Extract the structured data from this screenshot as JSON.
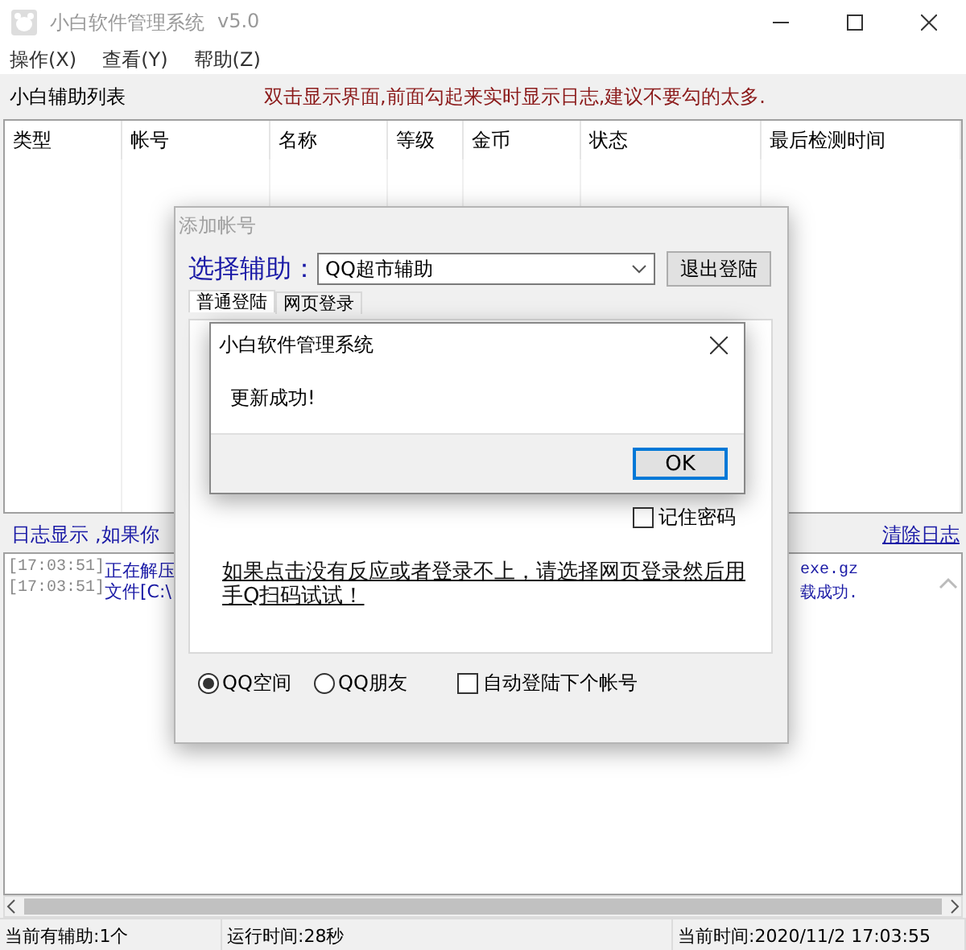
{
  "window": {
    "title": "小白软件管理系统",
    "version": "v5.0"
  },
  "menu": [
    {
      "label": "操作(X)"
    },
    {
      "label": "查看(Y)"
    },
    {
      "label": "帮助(Z)"
    }
  ],
  "list_panel": {
    "title": "小白辅助列表",
    "hint": "双击显示界面,前面勾起来实时显示日志,建议不要勾的太多."
  },
  "table": {
    "columns": [
      "类型",
      "帐号",
      "名称",
      "等级",
      "金币",
      "状态",
      "最后检测时间"
    ]
  },
  "log_bar": {
    "title": "日志显示",
    "message": ",如果你",
    "clear_link": "清除日志"
  },
  "log": [
    {
      "time": "[17:03:51]",
      "text": "正在解压",
      "tail": "exe.gz"
    },
    {
      "time": "[17:03:51]",
      "text": "文件[C:\\",
      "tail": "载成功."
    }
  ],
  "status_bar": [
    "当前有辅助:1个",
    "运行时间:28秒",
    "当前时间:2020/11/2 17:03:55"
  ],
  "add_account_dialog": {
    "title": "添加帐号",
    "select_label": "选择辅助：",
    "selected_helper": "QQ超市辅助",
    "logout_button": "退出登陆",
    "tabs": [
      {
        "label": "普通登陆",
        "selected": true
      },
      {
        "label": "网页登录",
        "selected": false
      }
    ],
    "remember_password": {
      "label": "记住密码",
      "checked": false
    },
    "help_link": "如果点击没有反应或者登录不上，请选择网页登录然后用手Q扫码试试！",
    "targets": [
      {
        "label": "QQ空间",
        "selected": true
      },
      {
        "label": "QQ朋友",
        "selected": false
      }
    ],
    "auto_next": {
      "label": "自动登陆下个帐号",
      "checked": false
    }
  },
  "message_box": {
    "title": "小白软件管理系统",
    "message": "更新成功!",
    "ok_button": "OK"
  }
}
